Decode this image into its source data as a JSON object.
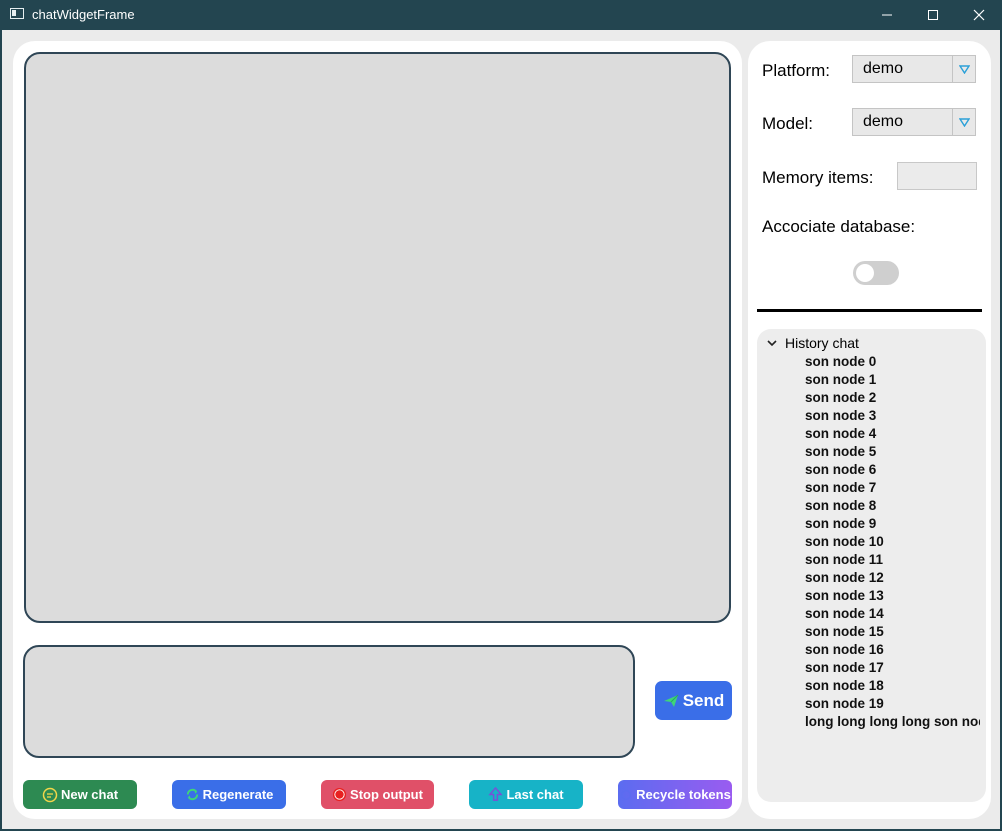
{
  "window": {
    "title": "chatWidgetFrame",
    "minimize_icon": "minimize-icon",
    "maximize_icon": "maximize-icon",
    "close_icon": "close-icon"
  },
  "chat": {
    "send_label": "Send",
    "send_icon": "paper-plane-icon"
  },
  "buttons": {
    "new_chat": "New chat",
    "regenerate": "Regenerate",
    "stop_output": "Stop output",
    "last_chat": "Last chat",
    "recycle_tokens": "Recycle tokens"
  },
  "settings": {
    "platform_label": "Platform:",
    "platform_value": "demo",
    "model_label": "Model:",
    "model_value": "demo",
    "memory_label": "Memory items:",
    "memory_value": "",
    "database_label": "Accociate database:",
    "database_enabled": false
  },
  "history": {
    "header": "History chat",
    "expanded": true,
    "items": [
      "son node 0",
      "son node 1",
      "son node 2",
      "son node 3",
      "son node 4",
      "son node 5",
      "son node 6",
      "son node 7",
      "son node 8",
      "son node 9",
      "son node 10",
      "son node 11",
      "son node 12",
      "son node 13",
      "son node 14",
      "son node 15",
      "son node 16",
      "son node 17",
      "son node 18",
      "son node 19",
      "long long long long son node"
    ]
  },
  "colors": {
    "titlebar": "#234550",
    "panel_border": "#2f4656",
    "send": "#3a6ee8",
    "new_chat": "#2d8a52",
    "regenerate": "#3a6ee8",
    "stop_output": "#e05068",
    "last_chat": "#17b3c7",
    "recycle_tokens": "#7a64f0"
  }
}
